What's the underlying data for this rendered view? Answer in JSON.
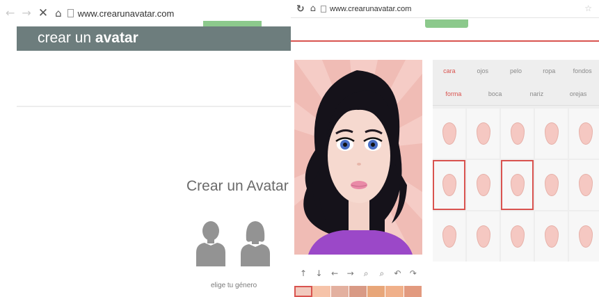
{
  "left_window": {
    "url": "www.crearunavatar.com",
    "banner": {
      "title_bold": "crear",
      "title_thin": "un",
      "title_bold2": "avatar"
    },
    "heading": "Crear un Avatar",
    "gender_prompt": "elige tu género",
    "icons": [
      "back-arrow-icon",
      "forward-arrow-icon",
      "stop-icon",
      "home-icon",
      "page-icon",
      "male-avatar-icon",
      "female-avatar-icon"
    ]
  },
  "right_window": {
    "url": "www.crearunavatar.com",
    "tabs": [
      {
        "label": "cara",
        "active": true
      },
      {
        "label": "ojos",
        "active": false
      },
      {
        "label": "pelo",
        "active": false
      },
      {
        "label": "ropa",
        "active": false
      },
      {
        "label": "fondos",
        "active": false
      }
    ],
    "subtabs": [
      {
        "label": "forma",
        "active": true
      },
      {
        "label": "boca",
        "active": false
      },
      {
        "label": "nariz",
        "active": false
      },
      {
        "label": "orejas",
        "active": false
      }
    ],
    "tools": [
      "up-arrow-icon",
      "down-arrow-icon",
      "left-arrow-icon",
      "right-arrow-icon",
      "zoom-out-icon",
      "zoom-in-icon",
      "undo-icon",
      "redo-icon"
    ],
    "skin_swatches": [
      "#f1c9be",
      "#f6c3a9",
      "#e3b09f",
      "#d99a85",
      "#e8a679",
      "#f0b08a",
      "#e29a7f"
    ],
    "colors": {
      "accent": "#d9534f",
      "banner": "#6d7d7d",
      "green_button": "#8cc98c"
    }
  }
}
